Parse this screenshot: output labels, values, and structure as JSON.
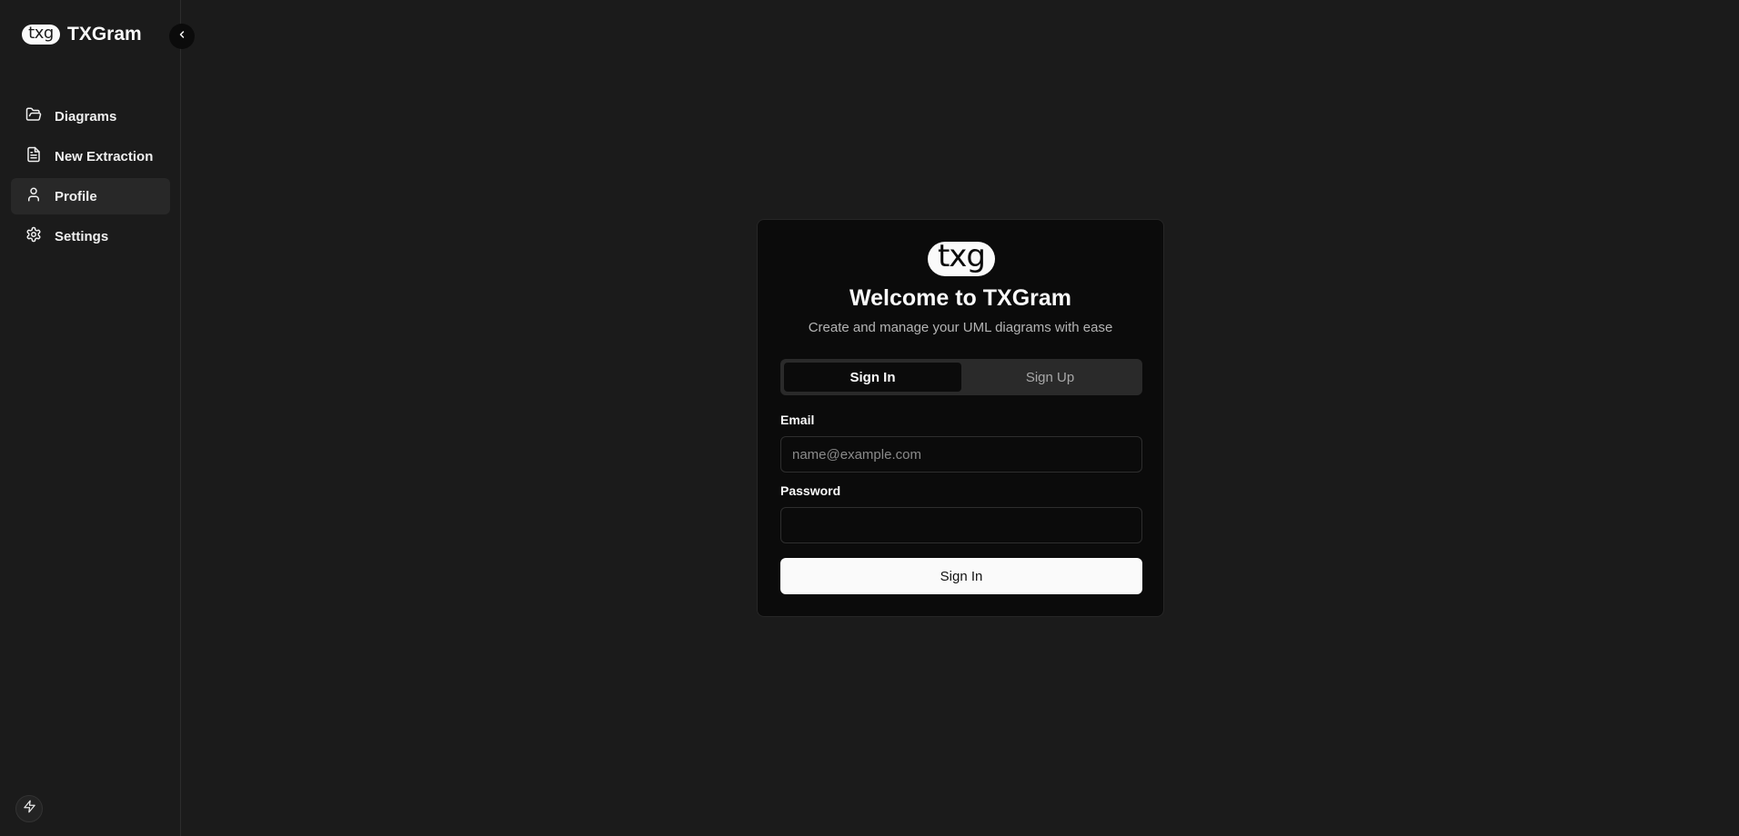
{
  "app": {
    "brand_logo": "txg",
    "brand_name": "TXGram"
  },
  "sidebar": {
    "collapse_icon": "chevron-left-icon",
    "items": [
      {
        "label": "Diagrams",
        "icon": "folder-open-icon",
        "active": false
      },
      {
        "label": "New Extraction",
        "icon": "file-text-icon",
        "active": false
      },
      {
        "label": "Profile",
        "icon": "user-icon",
        "active": true
      },
      {
        "label": "Settings",
        "icon": "gear-icon",
        "active": false
      }
    ],
    "footer_icon": "bolt-icon"
  },
  "auth": {
    "logo": "txg",
    "title": "Welcome to TXGram",
    "subtitle": "Create and manage your UML diagrams with ease",
    "tabs": [
      {
        "label": "Sign In",
        "active": true
      },
      {
        "label": "Sign Up",
        "active": false
      }
    ],
    "email": {
      "label": "Email",
      "placeholder": "name@example.com",
      "value": ""
    },
    "password": {
      "label": "Password",
      "placeholder": "",
      "value": ""
    },
    "submit_label": "Sign In"
  },
  "colors": {
    "background": "#1b1b1b",
    "card": "#0b0b0b",
    "primary_button": "#fafafa",
    "active_nav": "#282828"
  }
}
